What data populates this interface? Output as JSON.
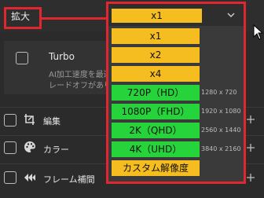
{
  "header": {
    "scale_label": "拡大",
    "selected_scale": "x1"
  },
  "turbo": {
    "label": "Turbo",
    "desc_line1": "AI加工速度を最適化",
    "desc_line2": "レードオフがありま"
  },
  "sections": [
    {
      "label": "編集",
      "icon": "edit-crop-icon"
    },
    {
      "label": "カラー",
      "icon": "palette-icon"
    },
    {
      "label": "フレーム補間",
      "icon": "frame-interpolation-icon"
    }
  ],
  "dropdown": {
    "options": [
      {
        "label": "x1",
        "resolution": "",
        "color": "#f5bd1f"
      },
      {
        "label": "x2",
        "resolution": "",
        "color": "#f5bd1f"
      },
      {
        "label": "x4",
        "resolution": "",
        "color": "#f5bd1f"
      },
      {
        "label": "720P（HD）",
        "resolution": "1280 x 720",
        "color": "#27d33a"
      },
      {
        "label": "1080P（FHD）",
        "resolution": "1920 x 1080",
        "color": "#27d33a"
      },
      {
        "label": "2K（QHD）",
        "resolution": "2560 x 1440",
        "color": "#27d33a"
      },
      {
        "label": "4K（UHD）",
        "resolution": "3840 x 2160",
        "color": "#27d33a"
      },
      {
        "label": "カスタム解像度",
        "resolution": "",
        "color": "#f5bd1f"
      }
    ]
  },
  "colors": {
    "highlight_red": "#e0262e",
    "option_yellow": "#f5bd1f",
    "option_green": "#27d33a",
    "background": "#2b2b2b"
  }
}
